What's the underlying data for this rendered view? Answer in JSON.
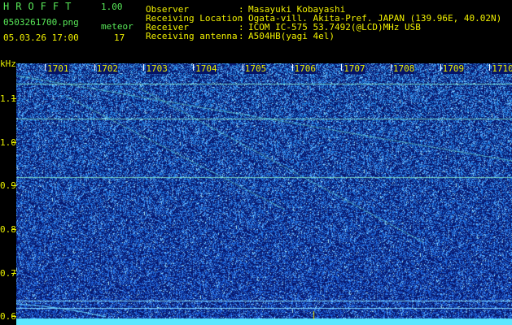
{
  "app": {
    "brand": "HROFFT",
    "version": "1.00",
    "filename": "0503261700.png",
    "datetime": "05.03.26 17:00",
    "meteor_label": "meteor",
    "meteor_count": "17"
  },
  "info": {
    "rows": [
      {
        "key": "Observer",
        "sep": ":",
        "value": "Masayuki Kobayashi"
      },
      {
        "key": "Receiving Location",
        "sep": ":",
        "value": "Ogata-vill. Akita-Pref. JAPAN (139.96E, 40.02N)"
      },
      {
        "key": "Receiver",
        "sep": ":",
        "value": "ICOM IC-575 53.7492(@LCD)MHz USB"
      },
      {
        "key": "Receiving antenna",
        "sep": ":",
        "value": "A504HB(yagi 4el)"
      }
    ]
  },
  "chart_data": {
    "type": "heatmap",
    "title": "",
    "ylabel": "kHz",
    "xlabel": "",
    "x_ticks": [
      "1701",
      "1702",
      "1703",
      "1704",
      "1705",
      "1706",
      "1707",
      "1708",
      "1709",
      "1710"
    ],
    "y_ticks": [
      "1.1",
      "1.0",
      "0.9",
      "0.8",
      "0.7",
      "0.6"
    ],
    "y_range": [
      0.58,
      1.18
    ],
    "colors": {
      "low": "#0b1a7a",
      "mid": "#2a5cf0",
      "high": "#9ff0ff",
      "carrier": "#5ee8ff",
      "text": "#e8f000"
    }
  }
}
